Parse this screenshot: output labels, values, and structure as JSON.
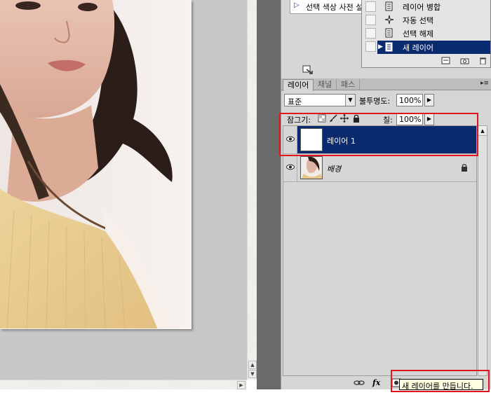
{
  "actions_panel": {
    "partial_row_text": "선택 색상 사전 설"
  },
  "context_menu": {
    "items": [
      {
        "label": "레이어 병합",
        "icon": "merge-layers-icon"
      },
      {
        "label": "자동 선택",
        "icon": "auto-select-icon"
      },
      {
        "label": "선택 해제",
        "icon": "deselect-icon"
      },
      {
        "label": "새 레이어",
        "icon": "new-layer-icon",
        "active": true
      }
    ]
  },
  "layers_panel": {
    "tabs": [
      {
        "label": "레이어",
        "active": true
      },
      {
        "label": "채널"
      },
      {
        "label": "패스"
      }
    ],
    "blend_mode": "표준",
    "opacity_label": "불투명도:",
    "opacity_value": "100%",
    "lock_label": "잠그기:",
    "fill_label": "칠:",
    "fill_value": "100%",
    "layers": [
      {
        "name": "레이어 1",
        "selected": true,
        "visible": true
      },
      {
        "name": "배경",
        "selected": false,
        "visible": true,
        "locked": true
      }
    ],
    "footer": {
      "fx_label": "fx"
    }
  },
  "tooltip": "새 레이어를 만듭니다.",
  "colors": {
    "selection": "#0a2a6e",
    "highlight_box": "#e0161e",
    "tooltip_bg": "#ffffe1"
  }
}
